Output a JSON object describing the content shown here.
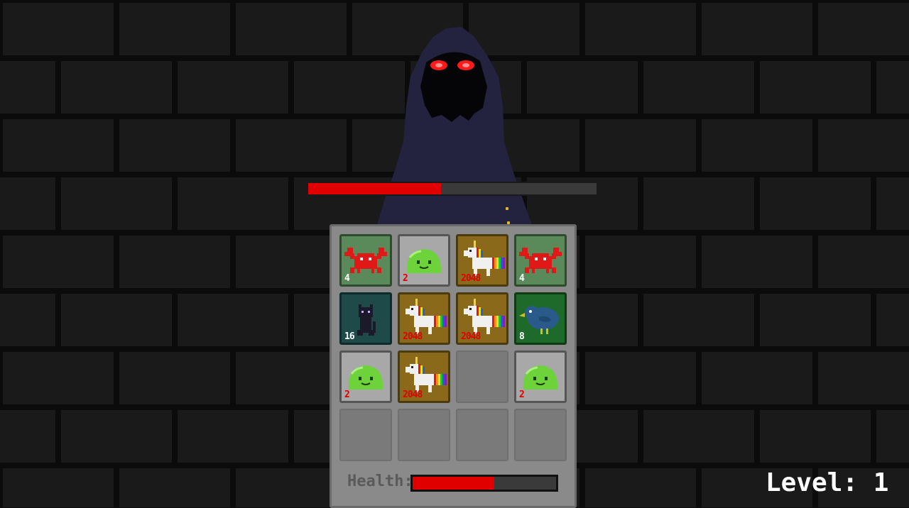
{
  "enemy": {
    "name_icon": "hooded-reaper-icon",
    "health_fraction": 0.46
  },
  "board": {
    "rows": [
      [
        {
          "kind": "crab",
          "value": "4"
        },
        {
          "kind": "slime",
          "value": "2"
        },
        {
          "kind": "unicorn",
          "value": "2048"
        },
        {
          "kind": "crab",
          "value": "4"
        }
      ],
      [
        {
          "kind": "cat",
          "value": "16"
        },
        {
          "kind": "unicorn",
          "value": "2048"
        },
        {
          "kind": "unicorn",
          "value": "2048"
        },
        {
          "kind": "bird",
          "value": "8"
        }
      ],
      [
        {
          "kind": "slime",
          "value": "2"
        },
        {
          "kind": "unicorn",
          "value": "2048"
        },
        null,
        {
          "kind": "slime",
          "value": "2"
        }
      ],
      [
        null,
        null,
        null,
        null
      ]
    ]
  },
  "player": {
    "health_label": "Health:",
    "health_fraction": 0.57
  },
  "level": {
    "label": "Level: 1"
  },
  "colors": {
    "health_red": "#e00000",
    "bar_bg": "#3a3a3a",
    "board": "#8a8a8a"
  }
}
